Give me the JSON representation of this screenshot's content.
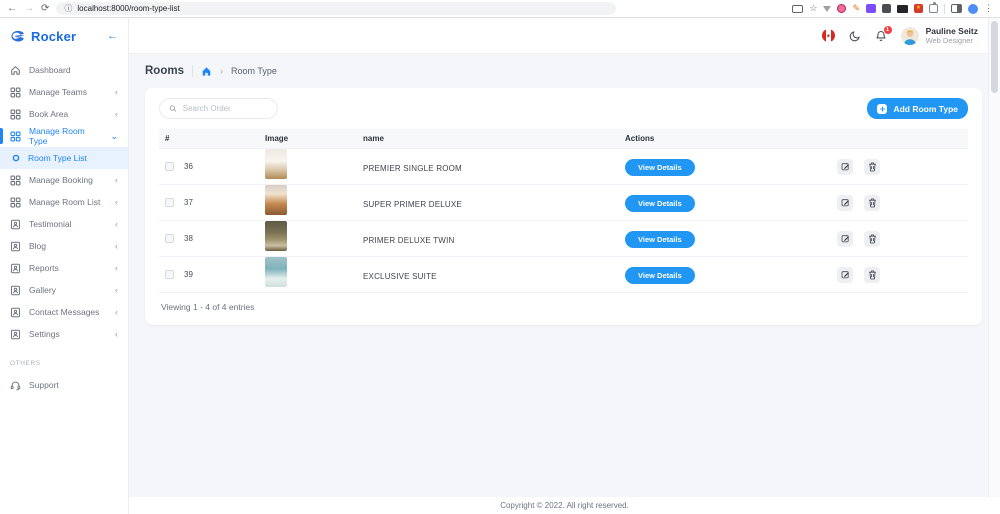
{
  "browser": {
    "url": "localhost:8000/room-type-list"
  },
  "icons": {
    "back": "←",
    "forward": "→",
    "reload": "⟳",
    "info": "ⓘ",
    "star": "☆",
    "ext_star": "★",
    "pencil": "✎",
    "menu_dots": "⋮",
    "chevron_left": "‹",
    "chevron_down": "⌄",
    "breadcrumb_sep": "›",
    "collapse_arrow": "←",
    "plus": "+"
  },
  "sidebar": {
    "logo_text": "Rocker",
    "items": [
      {
        "label": "Dashboard"
      },
      {
        "label": "Manage Teams"
      },
      {
        "label": "Book Area"
      },
      {
        "label": "Manage Room Type"
      },
      {
        "label": "Room Type List"
      },
      {
        "label": "Manage Booking"
      },
      {
        "label": "Manage Room List"
      },
      {
        "label": "Testimonial"
      },
      {
        "label": "Blog"
      },
      {
        "label": "Reports"
      },
      {
        "label": "Gallery"
      },
      {
        "label": "Contact Messages"
      },
      {
        "label": "Settings"
      }
    ],
    "section_label": "OTHERS",
    "support_label": "Support"
  },
  "header": {
    "notification_count": "1",
    "user_name": "Pauline Seitz",
    "user_role": "Web Designer"
  },
  "page": {
    "title": "Rooms",
    "breadcrumb": "Room Type"
  },
  "toolbar": {
    "search_placeholder": "Search Order",
    "add_button_label": "Add Room Type"
  },
  "table": {
    "headers": [
      "#",
      "Image",
      "name",
      "Actions"
    ],
    "rows": [
      {
        "id": "36",
        "name": "PREMIER SINGLE ROOM",
        "action_label": "View Details"
      },
      {
        "id": "37",
        "name": "SUPER PRIMER DELUXE",
        "action_label": "View Details"
      },
      {
        "id": "38",
        "name": "PRIMER DELUXE TWIN",
        "action_label": "View Details"
      },
      {
        "id": "39",
        "name": "EXCLUSIVE SUITE",
        "action_label": "View Details"
      }
    ],
    "summary": "Viewing 1 - 4 of 4 entries"
  },
  "footer": {
    "copyright": "Copyright © 2022. All right reserved."
  },
  "colors": {
    "accent_blue": "#2196f3",
    "logo_blue": "#1a6be0",
    "active_item_bg": "#e8f1fe",
    "badge_red": "#f23f3f",
    "flag_red": "#d52b1e",
    "main_bg": "#f5f6fa",
    "table_head_bg": "#f7f8fa"
  }
}
